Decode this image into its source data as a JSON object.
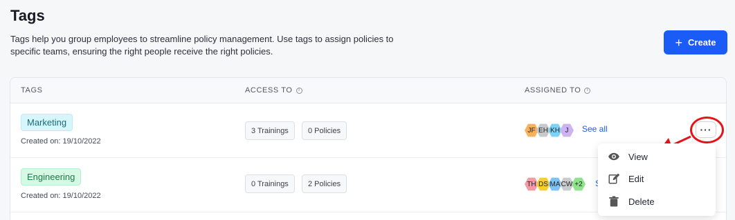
{
  "header": {
    "title": "Tags",
    "description": "Tags help you group employees to streamline policy management. Use tags to assign policies to specific teams, ensuring the right people receive the right policies.",
    "create_label": "Create",
    "create_icon": "plus-icon"
  },
  "table": {
    "columns": [
      "TAGS",
      "ACCESS TO",
      "ASSIGNED TO"
    ],
    "rows": [
      {
        "tag": "Marketing",
        "tag_color": "#d7f6fb",
        "created": "Created on: 19/10/2022",
        "trainings": "3 Trainings",
        "policies": "0 Policies",
        "avatars": [
          {
            "initials": "JF",
            "color": "#f6b15d"
          },
          {
            "initials": "EH",
            "color": "#c7c9cc"
          },
          {
            "initials": "KH",
            "color": "#7dd3f5"
          },
          {
            "initials": "J",
            "color": "#cdb3f1"
          }
        ],
        "see_all": "See all"
      },
      {
        "tag": "Engineering",
        "tag_color": "#d6f8e4",
        "created": "Created on: 19/10/2022",
        "trainings": "0 Trainings",
        "policies": "2 Policies",
        "avatars": [
          {
            "initials": "TH",
            "color": "#f29aa6"
          },
          {
            "initials": "DS",
            "color": "#f7d02f"
          },
          {
            "initials": "MA",
            "color": "#7dc3f5"
          },
          {
            "initials": "CW",
            "color": "#c9cbce"
          },
          {
            "initials": "+2",
            "color": "#8fe38a"
          }
        ],
        "see_all": "S"
      }
    ]
  },
  "row_menu": {
    "items": [
      {
        "label": "View",
        "icon": "eye-icon"
      },
      {
        "label": "Edit",
        "icon": "edit-icon"
      },
      {
        "label": "Delete",
        "icon": "trash-icon"
      }
    ],
    "more_glyph": "···"
  },
  "annotation_color": "#e3151a"
}
